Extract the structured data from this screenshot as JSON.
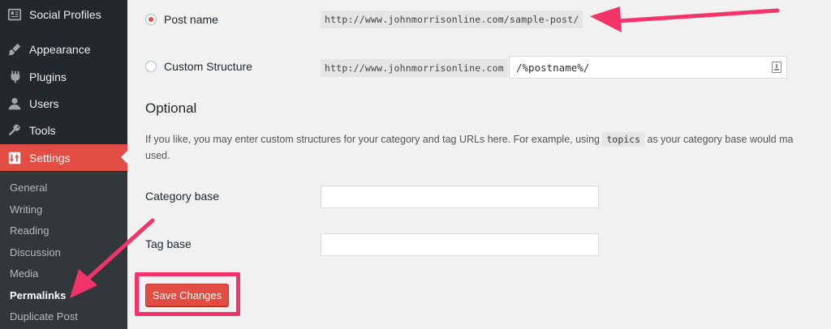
{
  "sidebar": {
    "menu": [
      {
        "label": "Social Profiles",
        "icon": "social-profiles-icon"
      },
      {
        "label": "Appearance",
        "icon": "paintbrush-icon"
      },
      {
        "label": "Plugins",
        "icon": "plugin-icon"
      },
      {
        "label": "Users",
        "icon": "user-icon"
      },
      {
        "label": "Tools",
        "icon": "wrench-icon"
      },
      {
        "label": "Settings",
        "icon": "settings-sliders-icon"
      }
    ],
    "submenu": [
      "General",
      "Writing",
      "Reading",
      "Discussion",
      "Media",
      "Permalinks",
      "Duplicate Post"
    ],
    "active_menu": "Settings",
    "current_submenu": "Permalinks"
  },
  "permalinks": {
    "post_name": {
      "label": "Post name",
      "example": "http://www.johnmorrisonline.com/sample-post/",
      "checked": true
    },
    "custom_structure": {
      "label": "Custom Structure",
      "prefix": "http://www.johnmorrisonline.com",
      "value": "/%postname%/",
      "checked": false
    }
  },
  "optional": {
    "heading": "Optional",
    "desc_before": "If you like, you may enter custom structures for your category and tag URLs here. For example, using",
    "desc_code": "topics",
    "desc_after": "as your category base would ma",
    "desc_line2": "used.",
    "category_base_label": "Category base",
    "category_base_value": "",
    "tag_base_label": "Tag base",
    "tag_base_value": ""
  },
  "save_label": "Save Changes",
  "colors": {
    "accent": "#e14d43",
    "annotation": "#f2346b",
    "sidebar": "#23282d"
  }
}
